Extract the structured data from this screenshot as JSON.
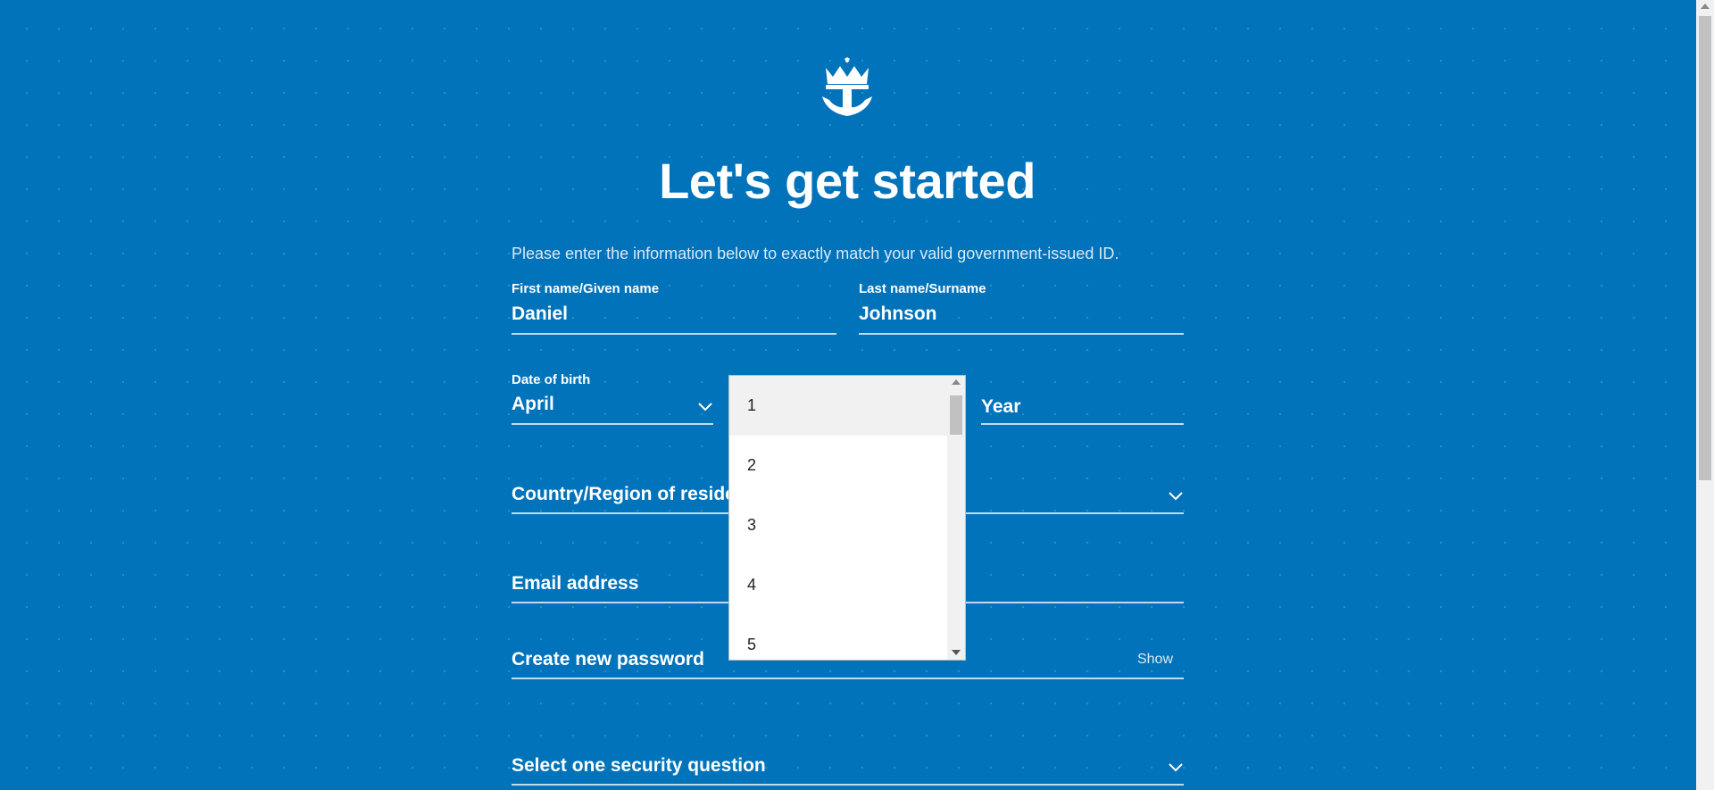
{
  "header": {
    "logo_icon": "crown-anchor-logo",
    "title": "Let's get started",
    "intro": "Please enter the information below to exactly match your valid government-issued ID."
  },
  "form": {
    "first_name": {
      "label": "First name/Given name",
      "value": "Daniel"
    },
    "last_name": {
      "label": "Last name/Surname",
      "value": "Johnson"
    },
    "dob": {
      "label": "Date of birth",
      "month_value": "April",
      "year_placeholder": "Year"
    },
    "country": {
      "placeholder": "Country/Region of reside"
    },
    "email": {
      "placeholder": "Email address"
    },
    "password": {
      "placeholder": "Create new password",
      "show_label": "Show"
    },
    "security_question": {
      "placeholder": "Select one security question"
    }
  },
  "day_dropdown": {
    "options": [
      "1",
      "2",
      "3",
      "4",
      "5"
    ],
    "highlighted_index": 0
  },
  "colors": {
    "background": "#0073bb",
    "text": "#ffffff",
    "dropdown_bg": "#ffffff",
    "highlight": "#f1f1f1"
  }
}
